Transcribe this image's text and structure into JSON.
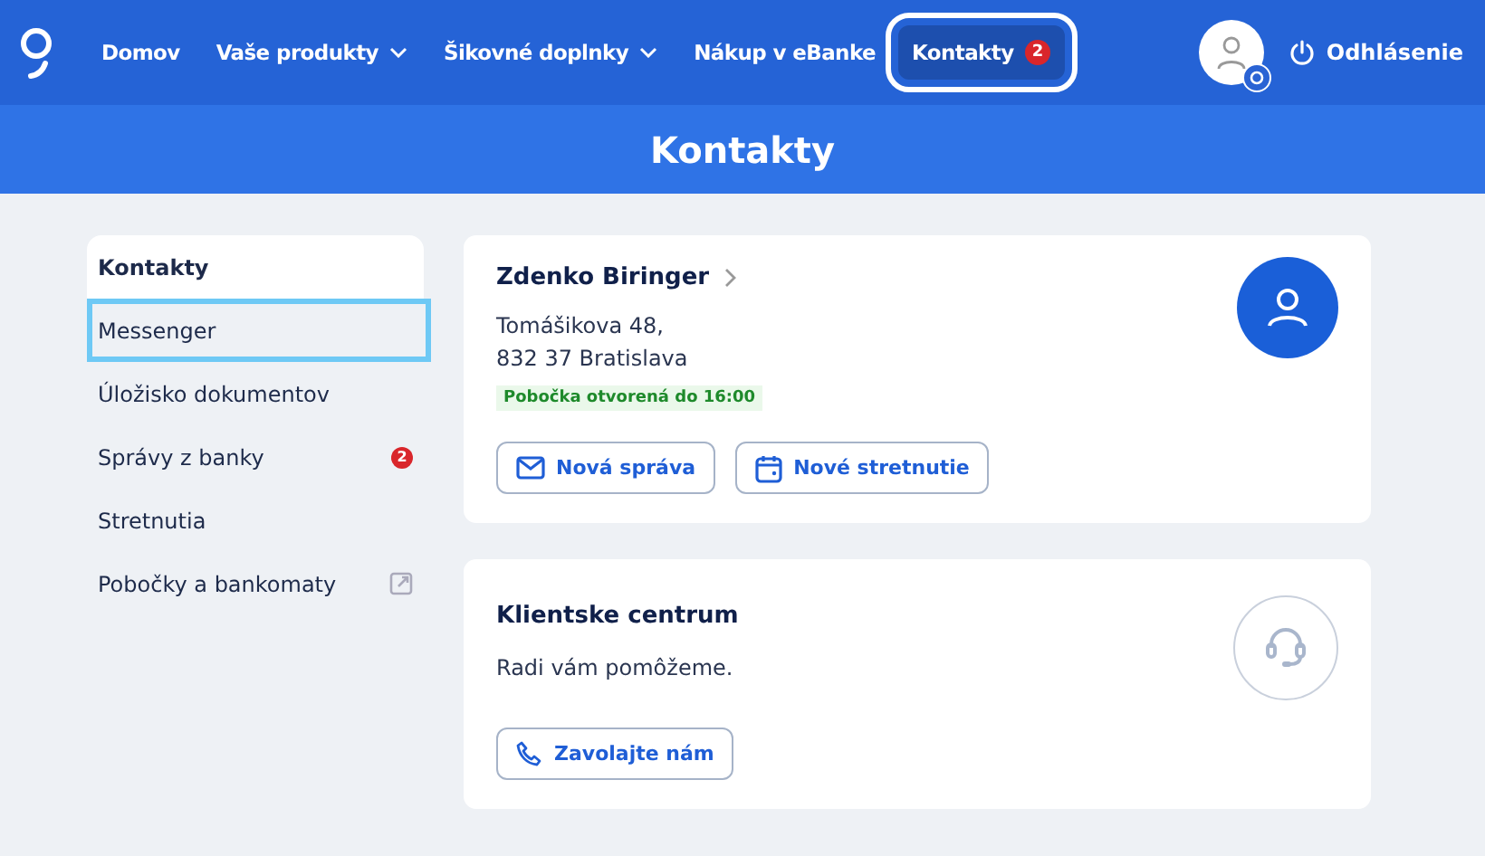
{
  "nav": {
    "items": [
      {
        "label": "Domov",
        "dropdown": false,
        "selected": false,
        "focused": false
      },
      {
        "label": "Vaše produkty",
        "dropdown": true,
        "selected": false,
        "focused": false
      },
      {
        "label": "Šikovné doplnky",
        "dropdown": true,
        "selected": false,
        "focused": false
      },
      {
        "label": "Nákup v eBanke",
        "dropdown": false,
        "selected": false,
        "focused": false
      },
      {
        "label": "Kontakty",
        "badge": "2",
        "dropdown": false,
        "selected": true,
        "focused": true
      }
    ],
    "logout": "Odhlásenie"
  },
  "page_title": "Kontakty",
  "sidebar": {
    "items": [
      {
        "label": "Kontakty",
        "external": false,
        "selected": true,
        "focused": false
      },
      {
        "label": "Messenger",
        "external": false,
        "selected": false,
        "focused": true
      },
      {
        "label": "Úložisko dokumentov",
        "external": false,
        "selected": false,
        "focused": false
      },
      {
        "label": "Správy z banky",
        "badge": "2",
        "external": false,
        "selected": false,
        "focused": false
      },
      {
        "label": "Stretnutia",
        "external": false,
        "selected": false,
        "focused": false
      },
      {
        "label": "Pobočky a bankomaty",
        "external": true,
        "selected": false,
        "focused": false
      }
    ]
  },
  "cards": [
    {
      "kind": "person",
      "title": "Zdenko Biringer",
      "link": true,
      "lines": [
        "Tomášikova 48,",
        "832 37 Bratislava"
      ],
      "status": "Pobočka otvorená do 16:00",
      "buttons": [
        {
          "label": "Nová správa",
          "kind": "message"
        },
        {
          "label": "Nové stretnutie",
          "kind": "meeting"
        }
      ]
    },
    {
      "kind": "center",
      "title": "Klientske centrum",
      "link": false,
      "lines": [
        "Radi vám pomôžeme."
      ],
      "buttons": [
        {
          "label": "Zavolajte nám",
          "kind": "call"
        }
      ]
    }
  ]
}
